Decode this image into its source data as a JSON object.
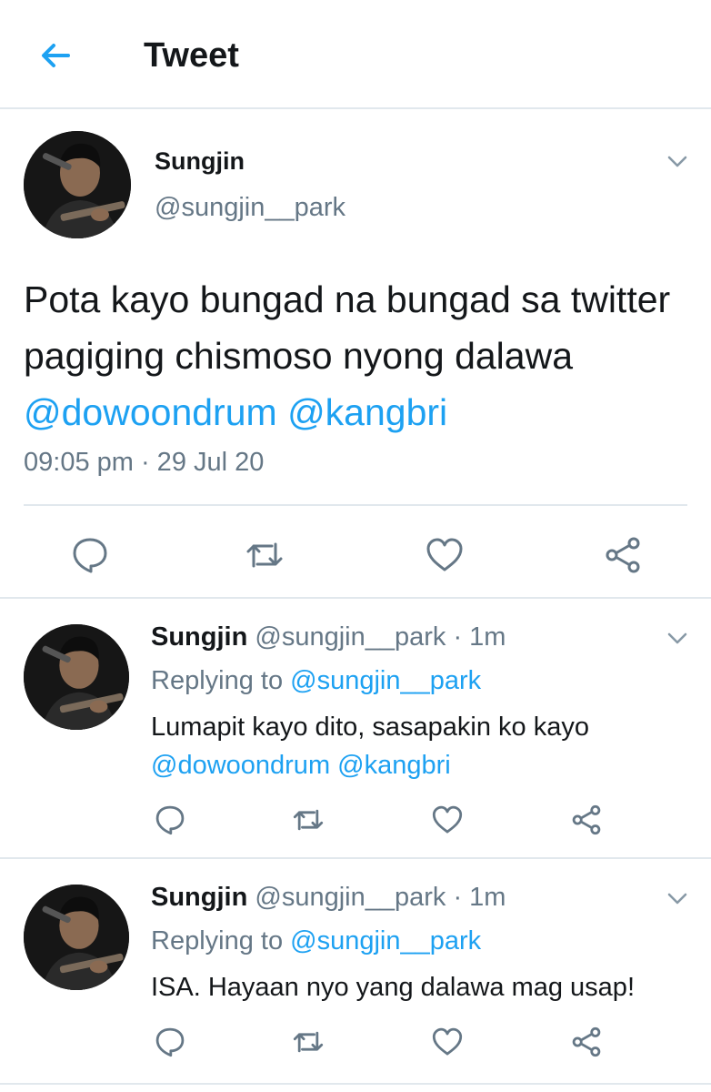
{
  "header": {
    "title": "Tweet",
    "back_icon": "arrow-left-icon"
  },
  "colors": {
    "accent": "#1da1f2",
    "secondary_text": "#657786",
    "primary_text": "#14171a",
    "divider": "#e1e8ed"
  },
  "main_tweet": {
    "name": "Sungjin",
    "handle": "@sungjin__park",
    "text": "Pota kayo bungad na bungad sa twitter pagiging chismoso nyong dalawa",
    "mention_1": "@dowoondrum",
    "mention_2": "@kangbri",
    "timestamp": "09:05 pm · 29 Jul 20",
    "actions": [
      "reply-icon",
      "retweet-icon",
      "like-icon",
      "share-icon"
    ]
  },
  "replies": [
    {
      "name": "Sungjin",
      "meta": "@sungjin__park · 1m",
      "replying_prefix": "Replying to",
      "replying_handle": "@sungjin__park",
      "text": "Lumapit kayo dito, sasapakin ko kayo",
      "mention_1": "@dowoondrum",
      "mention_2": "@kangbri"
    },
    {
      "name": "Sungjin",
      "meta": "@sungjin__park · 1m",
      "replying_prefix": "Replying to",
      "replying_handle": "@sungjin__park",
      "text": "ISA. Hayaan nyo yang dalawa mag usap!"
    }
  ]
}
